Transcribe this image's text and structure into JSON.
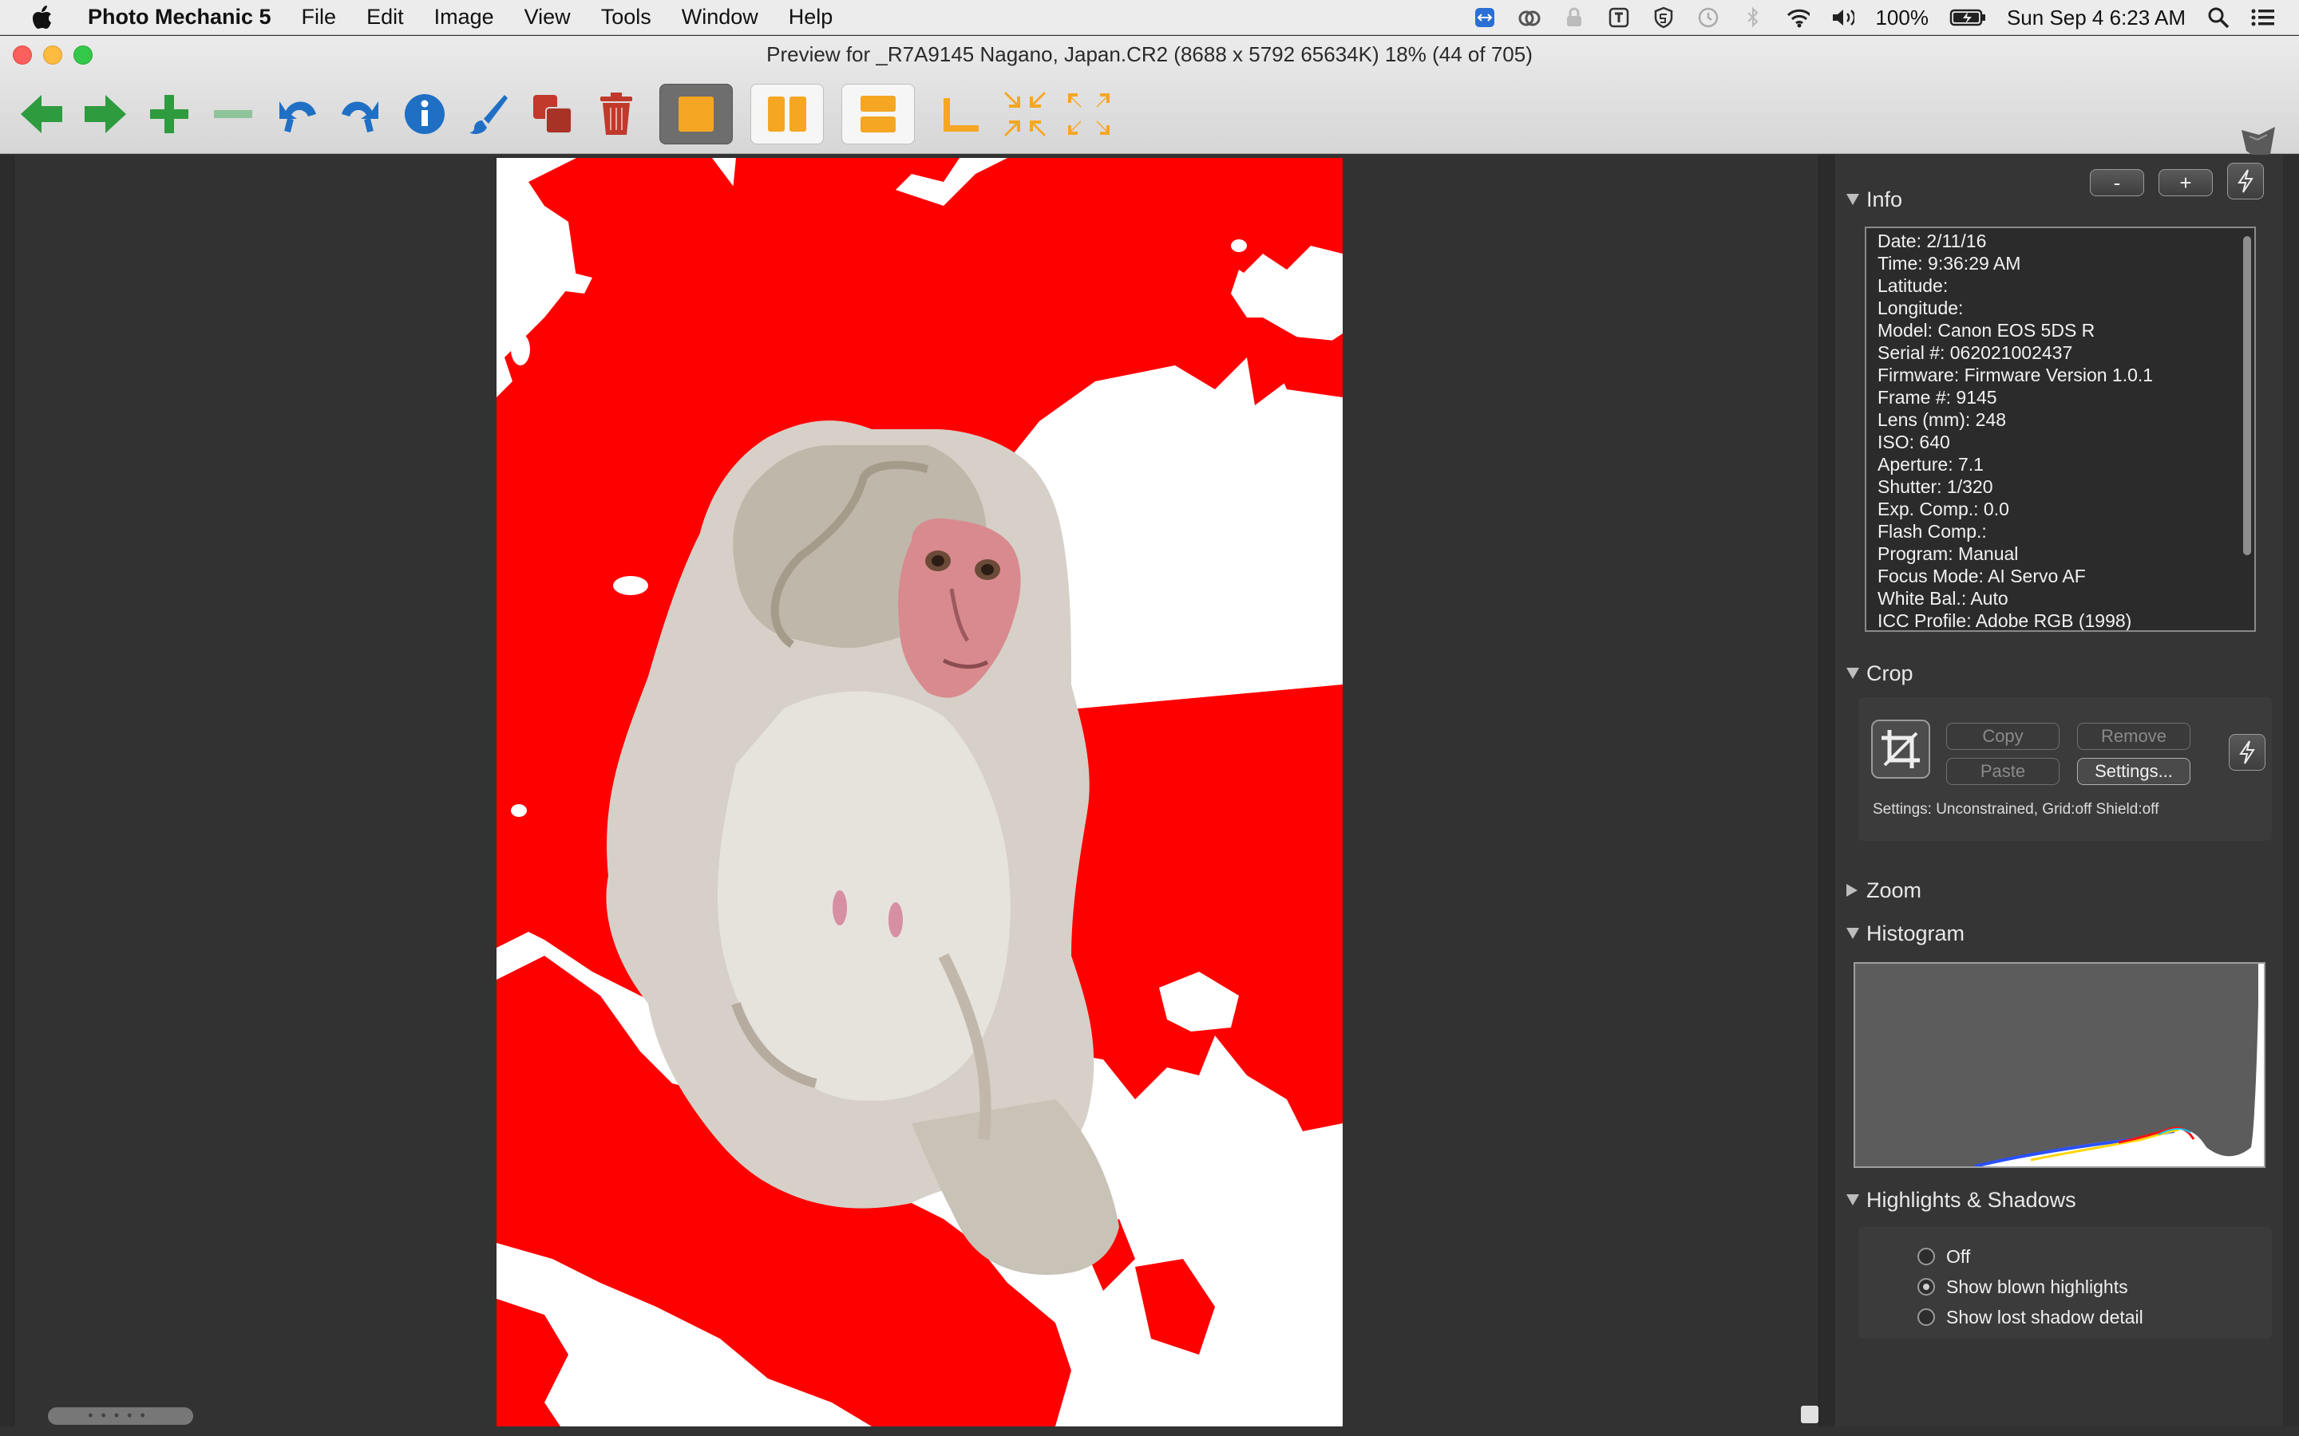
{
  "menubar": {
    "app_name": "Photo Mechanic 5",
    "items": [
      "File",
      "Edit",
      "Image",
      "View",
      "Tools",
      "Window",
      "Help"
    ],
    "battery": "100%",
    "datetime": "Sun Sep 4  6:23 AM"
  },
  "window": {
    "title": "Preview for _R7A9145 Nagano, Japan.CR2 (8688 x 5792 65634K) 18% (44 of 705)"
  },
  "toolbar": {
    "icons": [
      "back-arrow-icon",
      "forward-arrow-icon",
      "add-icon",
      "remove-icon",
      "rotate-left-icon",
      "rotate-right-icon",
      "info-icon",
      "edit-brush-icon",
      "duplicate-icon",
      "trash-icon",
      "single-view-icon",
      "side-by-side-icon",
      "stacked-view-icon",
      "crop-corner-icon",
      "shrink-icon",
      "expand-icon"
    ]
  },
  "panel": {
    "info": {
      "title": "Info",
      "minus_label": "-",
      "plus_label": "+",
      "lines": [
        "Date: 2/11/16",
        "Time: 9:36:29 AM",
        "Latitude:",
        "Longitude:",
        "Model: Canon EOS 5DS R",
        "Serial #: 062021002437",
        "Firmware: Firmware Version 1.0.1",
        "Frame #: 9145",
        "Lens (mm): 248",
        "ISO: 640",
        "Aperture: 7.1",
        "Shutter: 1/320",
        "Exp. Comp.: 0.0",
        "Flash Comp.:",
        "Program: Manual",
        "Focus Mode: AI Servo AF",
        "White Bal.: Auto",
        "ICC Profile: Adobe RGB (1998)"
      ]
    },
    "crop": {
      "title": "Crop",
      "copy_label": "Copy",
      "remove_label": "Remove",
      "paste_label": "Paste",
      "settings_label": "Settings...",
      "settings_text": "Settings:  Unconstrained, Grid:off Shield:off"
    },
    "zoom": {
      "title": "Zoom"
    },
    "histogram": {
      "title": "Histogram"
    },
    "highlights": {
      "title": "Highlights & Shadows",
      "options": [
        "Off",
        "Show blown highlights",
        "Show lost shadow detail"
      ],
      "selected": "Show blown highlights"
    }
  },
  "colors": {
    "highlight_warning": "#ff0000",
    "toolbar_green": "#2e9b3e",
    "toolbar_blue": "#1f6fc4",
    "toolbar_orange": "#f5a623",
    "toolbar_red": "#c0392b"
  }
}
